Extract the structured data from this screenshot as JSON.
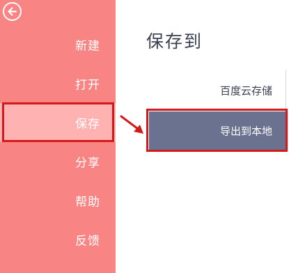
{
  "sidebar": {
    "items": [
      {
        "label": "新建"
      },
      {
        "label": "打开"
      },
      {
        "label": "保存"
      },
      {
        "label": "分享"
      },
      {
        "label": "帮助"
      },
      {
        "label": "反馈"
      }
    ],
    "active_item": "保存",
    "background_color": "#f88484",
    "active_color": "#ffb2b2"
  },
  "main": {
    "title": "保存到",
    "options": [
      {
        "label": "百度云存储"
      },
      {
        "label": "导出到本地"
      }
    ],
    "selected_option": "导出到本地",
    "selected_color": "#6b728f"
  },
  "annotation": {
    "highlight_color": "#d21a1a",
    "arrow_icon": "red-arrow-icon"
  },
  "icons": {
    "back": "back-arrow-circle-icon"
  }
}
